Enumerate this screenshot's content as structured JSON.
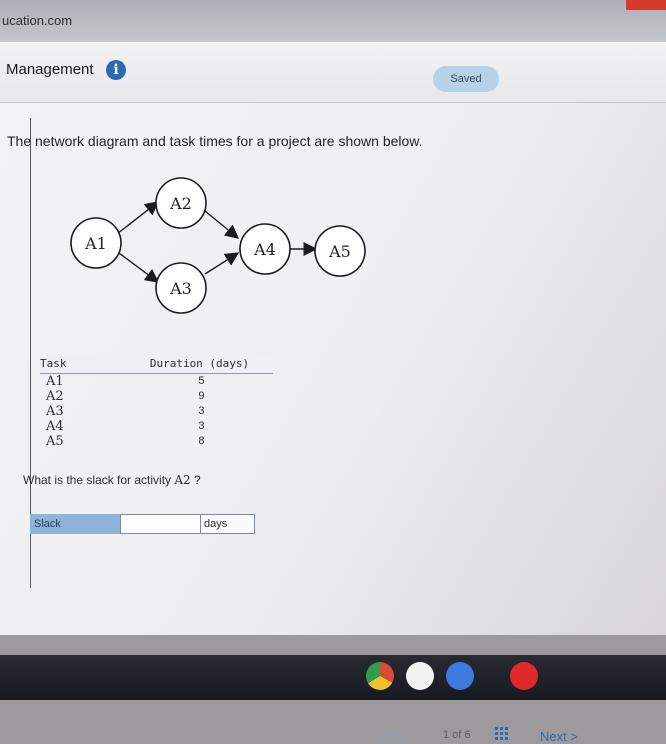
{
  "browser": {
    "url_fragment": "ucation.com"
  },
  "header": {
    "title": "Management",
    "saved_label": "Saved"
  },
  "question": {
    "text": "The network diagram and task times for a project are shown below."
  },
  "diagram": {
    "nodes": [
      "A1",
      "A2",
      "A3",
      "A4",
      "A5"
    ]
  },
  "table": {
    "col_task": "Task",
    "col_duration": "Duration (days)",
    "rows": [
      {
        "task": "A1",
        "duration": "5"
      },
      {
        "task": "A2",
        "duration": "9"
      },
      {
        "task": "A3",
        "duration": "3"
      },
      {
        "task": "A4",
        "duration": "3"
      },
      {
        "task": "A5",
        "duration": "8"
      }
    ]
  },
  "prompt": {
    "prefix": "What is the slack for activity",
    "activity": "A2",
    "suffix": "?"
  },
  "answer": {
    "label": "Slack",
    "value": "",
    "unit": "days"
  },
  "footer": {
    "prev": "Prev",
    "pager": "1 of 6",
    "next": "Next >"
  },
  "colors": {
    "accent": "#2c6bb0",
    "saved_bg": "#b7d1e6",
    "slack_label_bg": "#8fb3d9"
  }
}
